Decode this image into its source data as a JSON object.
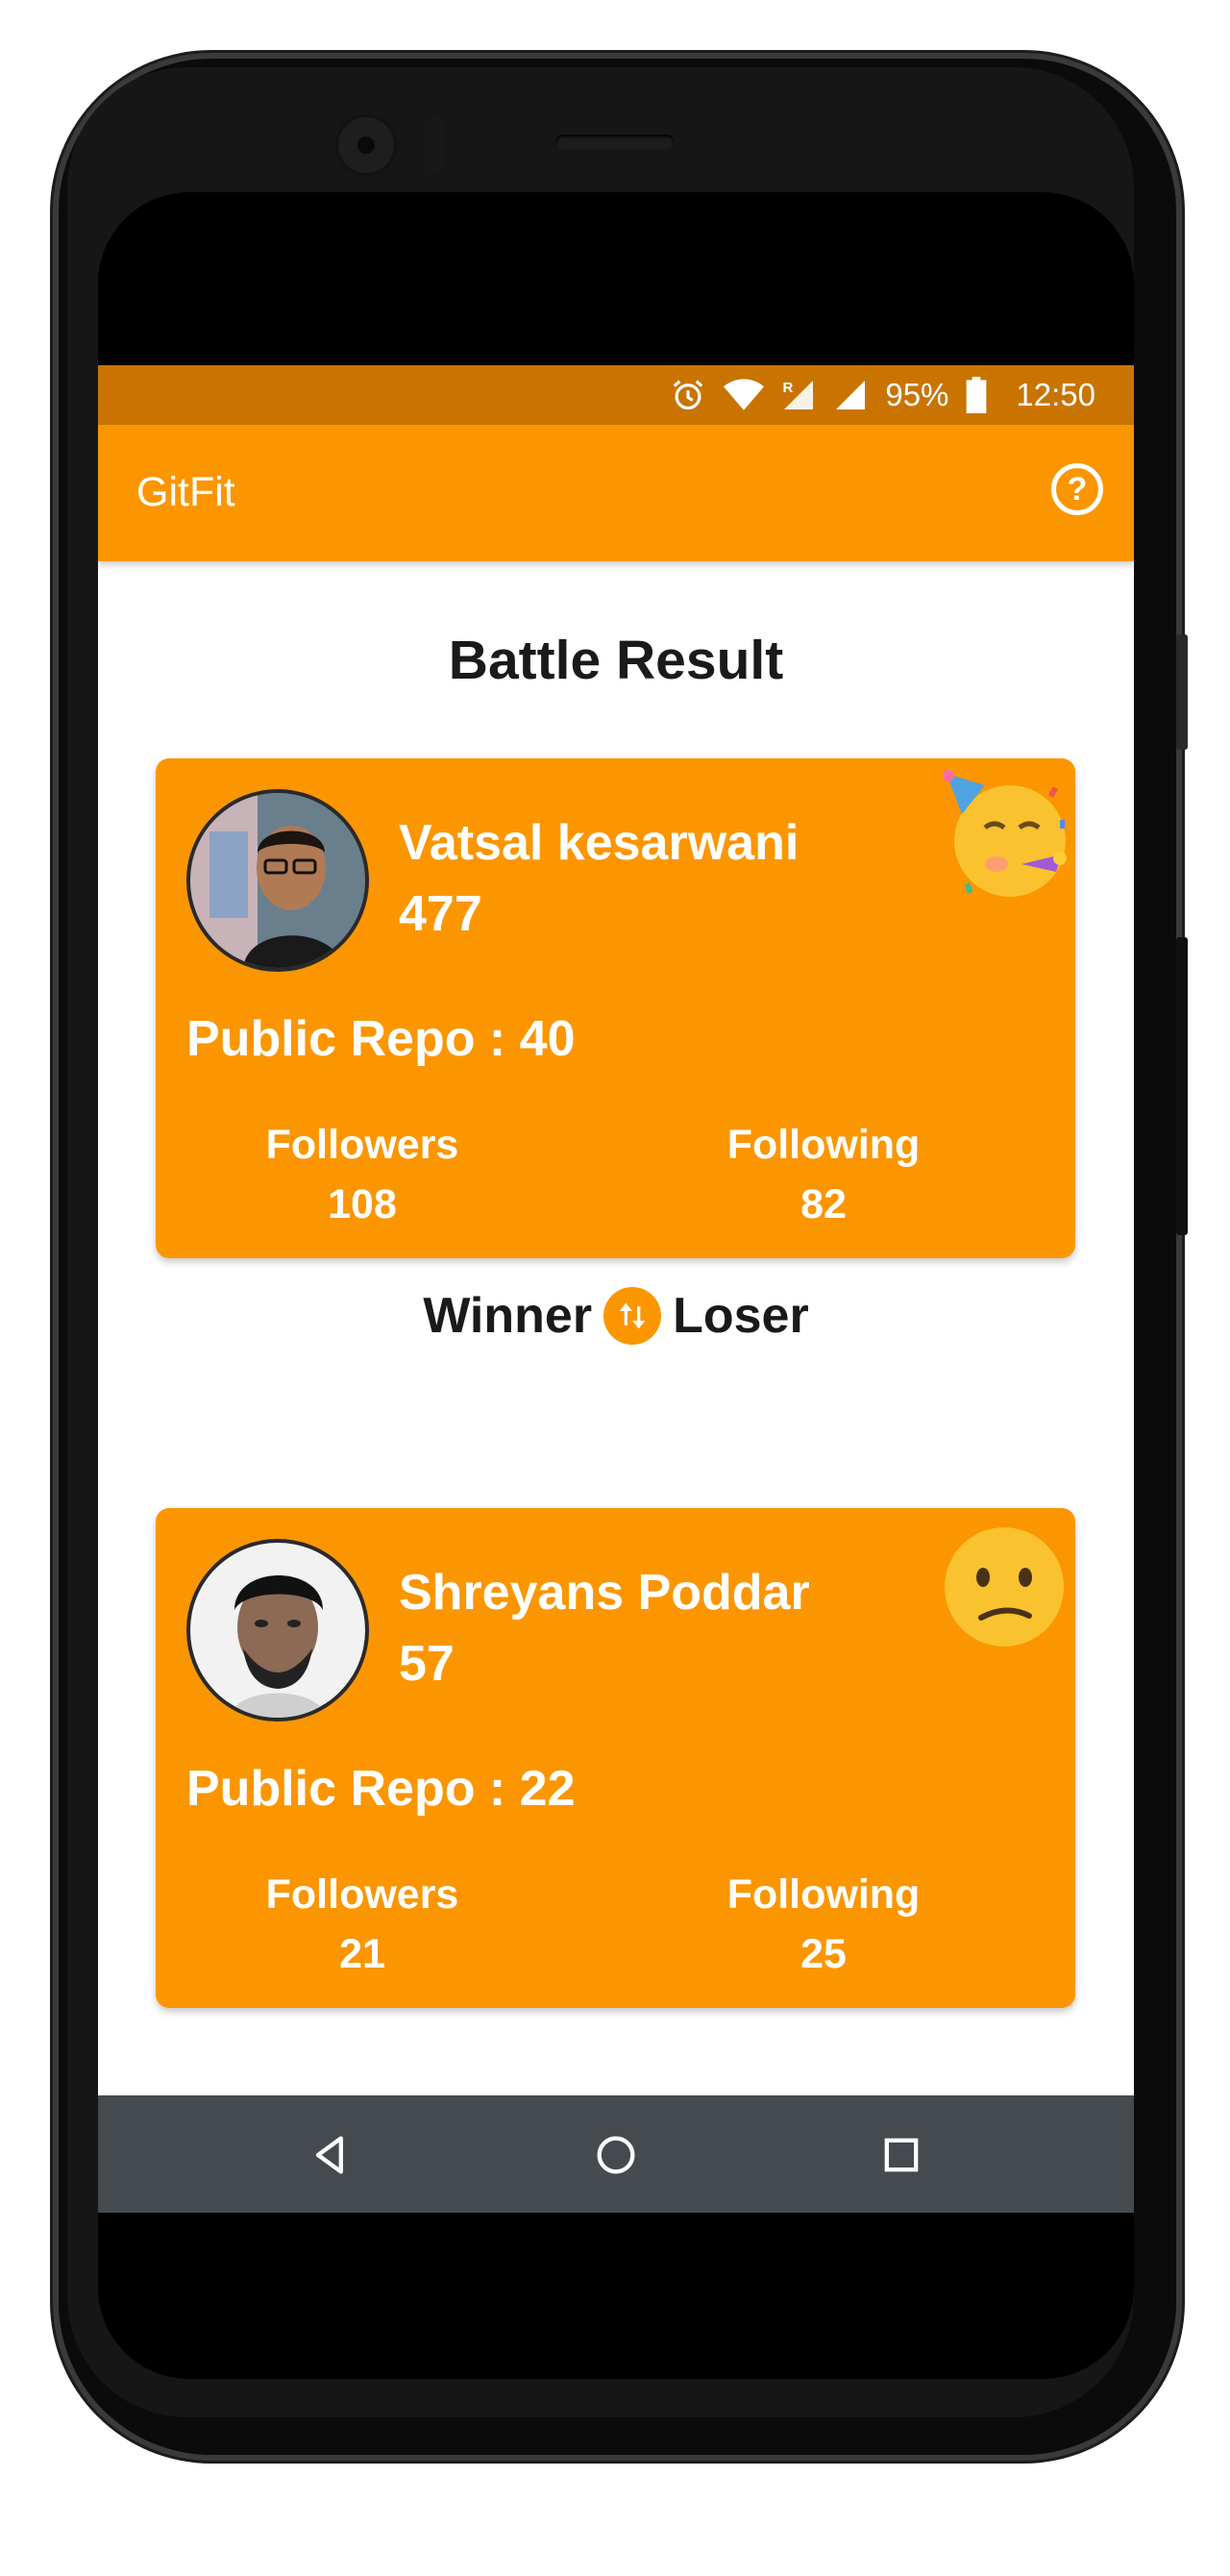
{
  "status_bar": {
    "battery": "95%",
    "time": "12:50",
    "icons": [
      "alarm-icon",
      "wifi-icon",
      "roaming-signal-icon",
      "cell-signal-icon",
      "battery-icon"
    ]
  },
  "app_bar": {
    "title": "GitFit",
    "help_icon": "help-circle-icon"
  },
  "main": {
    "heading": "Battle Result",
    "winner_label": "Winner",
    "loser_label": "Loser",
    "swap_icon": "swap-vertical-icon",
    "cards": [
      {
        "name": "Vatsal kesarwani",
        "score": "477",
        "public_repo": "Public Repo : 40",
        "followers_label": "Followers",
        "followers": "108",
        "following_label": "Following",
        "following": "82",
        "emoji": "partying-face-emoji"
      },
      {
        "name": "Shreyans Poddar",
        "score": "57",
        "public_repo": "Public Repo : 22",
        "followers_label": "Followers",
        "followers": "21",
        "following_label": "Following",
        "following": "25",
        "emoji": "confused-face-emoji"
      }
    ]
  },
  "nav_bar": {
    "icons": [
      "back-icon",
      "home-icon",
      "recents-icon"
    ]
  },
  "colors": {
    "accent": "#fb9600",
    "status_bar": "#c97400",
    "nav_bar": "#454a4e"
  }
}
